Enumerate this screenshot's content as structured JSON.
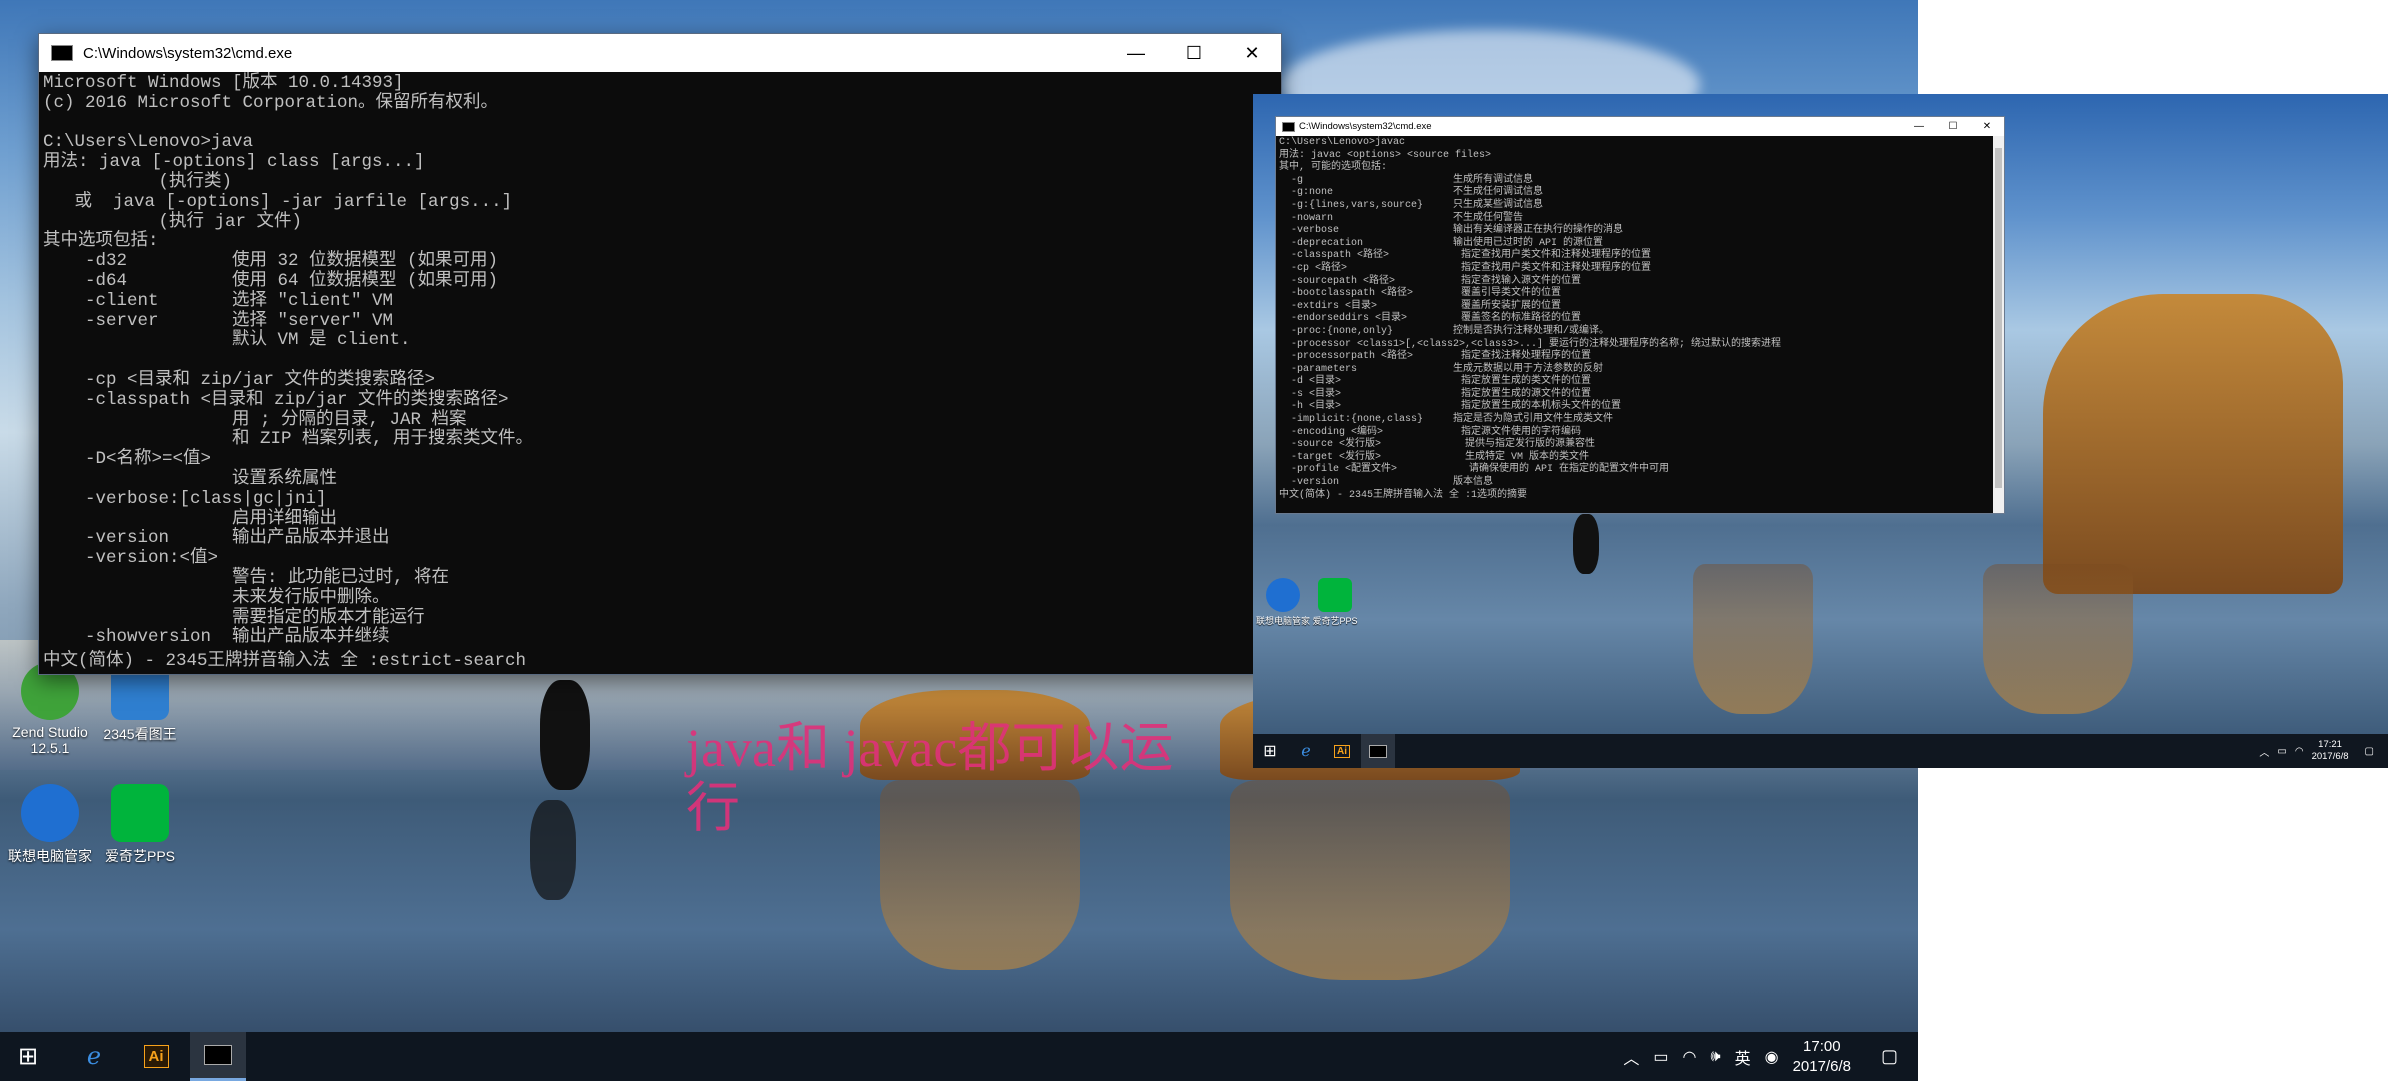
{
  "left_desktop": {
    "icons": [
      {
        "label": "Zend Studio\n12.5.1",
        "color": "#3fa33a"
      },
      {
        "label": "2345看图王",
        "color": "#2f7fd0"
      },
      {
        "label": "联想电脑管家",
        "color": "#1f6fd1"
      },
      {
        "label": "爱奇艺PPS",
        "color": "#00b43c"
      }
    ],
    "taskbar": {
      "start_icon": "windows-start-icon",
      "pinned": [
        "edge-icon",
        "illustrator-icon",
        "cmd-icon"
      ],
      "tray": {
        "ime_lang": "英",
        "time": "17:00",
        "date": "2017/6/8"
      }
    }
  },
  "cmd_window": {
    "title": "C:\\Windows\\system32\\cmd.exe",
    "lines": [
      "Microsoft Windows [版本 10.0.14393]",
      "(c) 2016 Microsoft Corporation。保留所有权利。",
      "",
      "C:\\Users\\Lenovo>java",
      "用法: java [-options] class [args...]",
      "           (执行类)",
      "   或  java [-options] -jar jarfile [args...]",
      "           (执行 jar 文件)",
      "其中选项包括:",
      "    -d32          使用 32 位数据模型 (如果可用)",
      "    -d64          使用 64 位数据模型 (如果可用)",
      "    -client       选择 \"client\" VM",
      "    -server       选择 \"server\" VM",
      "                  默认 VM 是 client.",
      "",
      "    -cp <目录和 zip/jar 文件的类搜索路径>",
      "    -classpath <目录和 zip/jar 文件的类搜索路径>",
      "                  用 ; 分隔的目录, JAR 档案",
      "                  和 ZIP 档案列表, 用于搜索类文件。",
      "    -D<名称>=<值>",
      "                  设置系统属性",
      "    -verbose:[class|gc|jni]",
      "                  启用详细输出",
      "    -version      输出产品版本并退出",
      "    -version:<值>",
      "                  警告: 此功能已过时, 将在",
      "                  未来发行版中删除。",
      "                  需要指定的版本才能运行",
      "    -showversion  输出产品版本并继续"
    ],
    "ime_status": "中文(简体) - 2345王牌拼音输入法 全 :estrict-search"
  },
  "annotation": "java和   javac都可以运行",
  "right_screen": {
    "cmd_window": {
      "title": "C:\\Windows\\system32\\cmd.exe",
      "lines": [
        "C:\\Users\\Lenovo>javac",
        "用法: javac <options> <source files>",
        "其中, 可能的选项包括:",
        "  -g                         生成所有调试信息",
        "  -g:none                    不生成任何调试信息",
        "  -g:{lines,vars,source}     只生成某些调试信息",
        "  -nowarn                    不生成任何警告",
        "  -verbose                   输出有关编译器正在执行的操作的消息",
        "  -deprecation               输出使用已过时的 API 的源位置",
        "  -classpath <路径>            指定查找用户类文件和注释处理程序的位置",
        "  -cp <路径>                   指定查找用户类文件和注释处理程序的位置",
        "  -sourcepath <路径>           指定查找输入源文件的位置",
        "  -bootclasspath <路径>        覆盖引导类文件的位置",
        "  -extdirs <目录>              覆盖所安装扩展的位置",
        "  -endorseddirs <目录>         覆盖签名的标准路径的位置",
        "  -proc:{none,only}          控制是否执行注释处理和/或编译。",
        "  -processor <class1>[,<class2>,<class3>...] 要运行的注释处理程序的名称; 绕过默认的搜索进程",
        "  -processorpath <路径>        指定查找注释处理程序的位置",
        "  -parameters                生成元数据以用于方法参数的反射",
        "  -d <目录>                    指定放置生成的类文件的位置",
        "  -s <目录>                    指定放置生成的源文件的位置",
        "  -h <目录>                    指定放置生成的本机标头文件的位置",
        "  -implicit:{none,class}     指定是否为隐式引用文件生成类文件",
        "  -encoding <编码>             指定源文件使用的字符编码",
        "  -source <发行版>              提供与指定发行版的源兼容性",
        "  -target <发行版>              生成特定 VM 版本的类文件",
        "  -profile <配置文件>            请确保使用的 API 在指定的配置文件中可用",
        "  -version                   版本信息",
        "中文(简体) - 2345王牌拼音输入法 全 :1选项的摘要"
      ]
    },
    "icons": [
      {
        "label": "联想电脑管家",
        "color": "#1f6fd1"
      },
      {
        "label": "爱奇艺PPS",
        "color": "#00b43c"
      }
    ],
    "taskbar": {
      "time": "17:21",
      "date": "2017/6/8"
    }
  }
}
